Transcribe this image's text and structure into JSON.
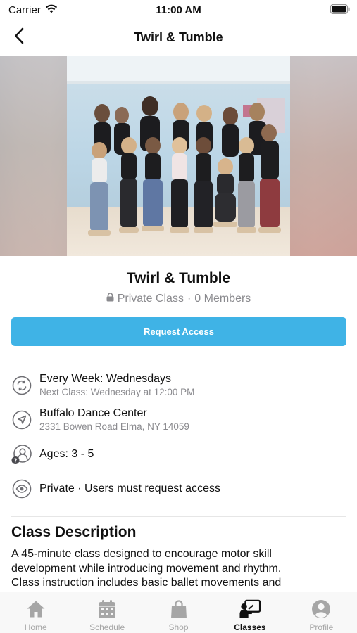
{
  "status_bar": {
    "carrier": "Carrier",
    "time": "11:00 AM"
  },
  "nav": {
    "title": "Twirl & Tumble",
    "back_icon": "chevron-left-icon"
  },
  "class_info": {
    "title": "Twirl & Tumble",
    "privacy": "Private Class",
    "separator": "·",
    "members": "0 Members"
  },
  "request_button": {
    "label": "Request Access",
    "color": "#3fb3e6"
  },
  "details": [
    {
      "icon": "repeat-icon",
      "main": "Every Week: Wednesdays",
      "sub": "Next Class: Wednesday at 12:00 PM"
    },
    {
      "icon": "location-arrow-icon",
      "main": "Buffalo Dance Center",
      "sub": "2331 Bowen Road Elma, NY 14059"
    },
    {
      "icon": "age-group-icon",
      "main": "Ages: 3 - 5",
      "sub": ""
    },
    {
      "icon": "eye-icon",
      "main": "Private · Users must request access",
      "sub": ""
    }
  ],
  "description": {
    "heading": "Class Description",
    "lines": [
      "A 45-minute class designed to encourage motor skill",
      "development while introducing movement and rhythm.",
      "Class instruction includes basic ballet movements and"
    ]
  },
  "tabs": [
    {
      "label": "Home",
      "icon": "home-icon",
      "active": false
    },
    {
      "label": "Schedule",
      "icon": "calendar-icon",
      "active": false
    },
    {
      "label": "Shop",
      "icon": "shopping-bag-icon",
      "active": false
    },
    {
      "label": "Classes",
      "icon": "classes-icon",
      "active": true
    },
    {
      "label": "Profile",
      "icon": "profile-icon",
      "active": false
    }
  ]
}
